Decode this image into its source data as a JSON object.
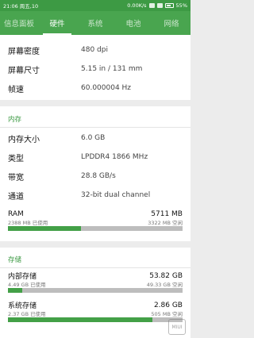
{
  "status_bar": {
    "time_day": "21:06 周五,10",
    "network_speed": "0.00K/s",
    "battery": "55%"
  },
  "tabs": [
    {
      "label": "信息面板",
      "active": false
    },
    {
      "label": "硬件",
      "active": true
    },
    {
      "label": "系统",
      "active": false
    },
    {
      "label": "电池",
      "active": false
    },
    {
      "label": "网络",
      "active": false
    }
  ],
  "display_info": [
    {
      "label": "屏幕密度",
      "value": "480 dpi"
    },
    {
      "label": "屏幕尺寸",
      "value": "5.15 in / 131 mm"
    },
    {
      "label": "帧速",
      "value": "60.000004 Hz"
    }
  ],
  "memory": {
    "title": "内存",
    "rows": [
      {
        "label": "内存大小",
        "value": "6.0 GB"
      },
      {
        "label": "类型",
        "value": "LPDDR4 1866 MHz"
      },
      {
        "label": "带宽",
        "value": "28.8 GB/s"
      },
      {
        "label": "通道",
        "value": "32-bit dual channel"
      }
    ],
    "ram": {
      "label": "RAM",
      "total": "5711 MB",
      "used": "2388 MB 已使用",
      "free": "3322 MB 空闲",
      "used_fraction": 0.418
    }
  },
  "storage": {
    "title": "存储",
    "items": [
      {
        "label": "内部存储",
        "total": "53.82 GB",
        "used": "4.49 GB 已使用",
        "free": "49.33 GB 空闲",
        "used_fraction": 0.083
      },
      {
        "label": "系统存储",
        "total": "2.86 GB",
        "used": "2.37 GB 已使用",
        "free": "505 MB 空闲",
        "used_fraction": 0.828
      }
    ]
  },
  "watermark": "MIUI"
}
